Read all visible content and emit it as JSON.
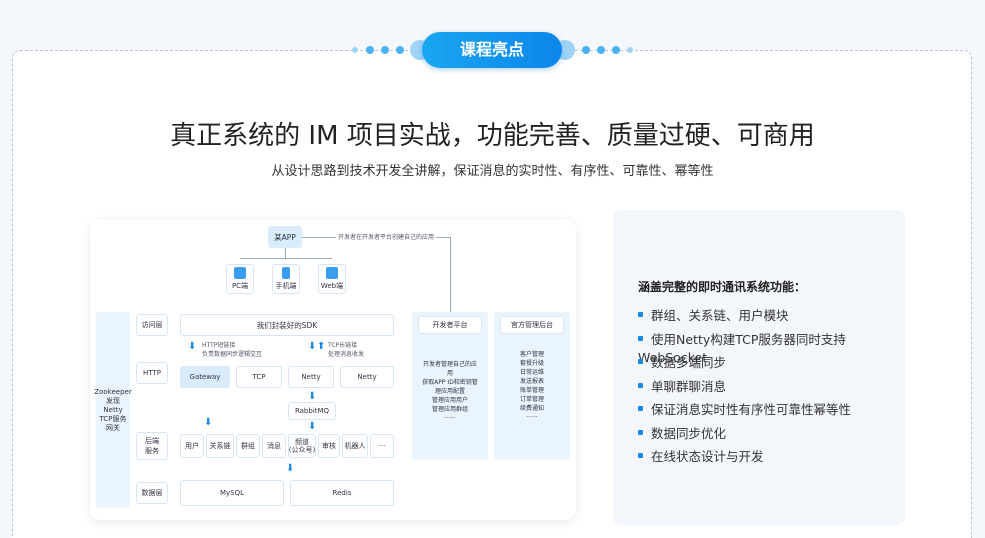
{
  "section": {
    "badge": "课程亮点"
  },
  "heading": {
    "title": "真正系统的 IM 项目实战，功能完善、质量过硬、可商用",
    "subtitle": "从设计思路到技术开发全讲解，保证消息的实时性、有序性、可靠性、幂等性"
  },
  "diagram": {
    "app": "某APP",
    "app_note": "开发者在开发者平台创建自己的应用",
    "clients": [
      "PC端",
      "手机端",
      "Web端"
    ],
    "left_column": [
      "Zookeeper",
      "发现",
      "Netty",
      "TCP服务",
      "网关"
    ],
    "layers": [
      "访问层",
      "HTTP",
      "后端",
      "服务",
      "数据层"
    ],
    "layer_backend": "后端\n服务",
    "sdk": "我们封装好的SDK",
    "http_note_1": "HTTP短链接",
    "http_note_2": "负责数据同步逻辑交互",
    "tcp_note_1": "TCP长链接",
    "tcp_note_2": "处理消息收发",
    "gateways": [
      "Gateway",
      "TCP",
      "Netty",
      "Netty"
    ],
    "mq": "RabbitMQ",
    "services": [
      "用户",
      "关系链",
      "群组",
      "消息",
      "频道\n(公众号)",
      "审核",
      "机器人",
      "···"
    ],
    "stores": [
      "MySQL",
      "Redis"
    ],
    "dev_platform": {
      "title": "开发者平台",
      "items": [
        "开发者管理自己的应",
        "用",
        "获取APP ID和密钥管",
        "理应用配置",
        "管理应用用户",
        "管理应用群组",
        "······"
      ]
    },
    "admin_platform": {
      "title": "官方管理后台",
      "items": [
        "客户管理",
        "套餐升级",
        "日常运维",
        "发送报表",
        "账单管理",
        "订单管理",
        "续费通知",
        "······"
      ]
    }
  },
  "features": {
    "heading": "涵盖完整的即时通讯系统功能：",
    "items": [
      "群组、关系链、用户模块",
      "使用Netty构建TCP服务器同时支持WebSocket",
      "数据多端同步",
      "单聊群聊消息",
      "保证消息实时性有序性可靠性幂等性",
      "数据同步优化",
      "在线状态设计与开发"
    ]
  }
}
